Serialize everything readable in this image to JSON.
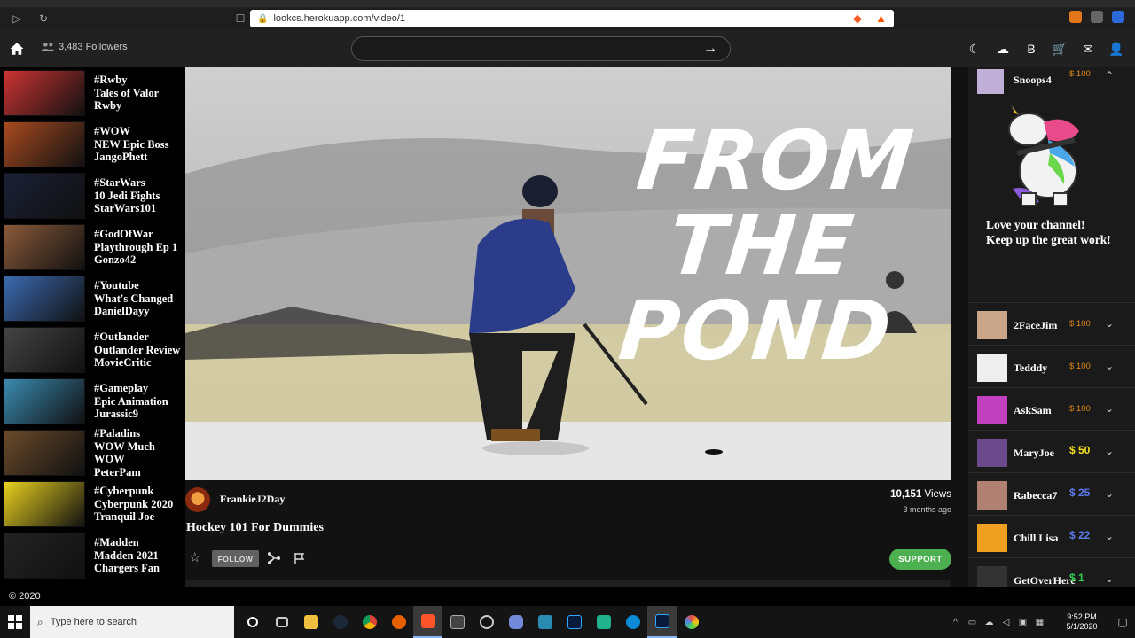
{
  "browser": {
    "url": "lookcs.herokuapp.com/video/1"
  },
  "header": {
    "followers": "3,483 Followers",
    "search_placeholder": ""
  },
  "sidebar": {
    "items": [
      {
        "tag": "#Rwby",
        "title": "Tales of Valor",
        "user": "Rwby",
        "color": "#c33"
      },
      {
        "tag": "#WOW",
        "title": "NEW Epic Boss",
        "user": "JangoPhett",
        "color": "#a84a20"
      },
      {
        "tag": "#StarWars",
        "title": "10 Jedi Fights",
        "user": "StarWars101",
        "color": "#1a2035"
      },
      {
        "tag": "#GodOfWar",
        "title": "Playthrough Ep 1",
        "user": "Gonzo42",
        "color": "#8a5a3a"
      },
      {
        "tag": "#Youtube",
        "title": "What's Changed",
        "user": "DanielDayy",
        "color": "#3a6ab0"
      },
      {
        "tag": "#Outlander",
        "title": "Outlander Review",
        "user": "MovieCritic",
        "color": "#444"
      },
      {
        "tag": "#Gameplay",
        "title": "Epic Animation",
        "user": "Jurassic9",
        "color": "#3a8ab0"
      },
      {
        "tag": "#Paladins",
        "title": "WOW Much WOW",
        "user": "PeterPam",
        "color": "#6a4a2a"
      },
      {
        "tag": "#Cyberpunk",
        "title": "Cyberpunk 2020",
        "user": "Tranquil Joe",
        "color": "#e8d020"
      },
      {
        "tag": "#Madden",
        "title": "Madden 2021",
        "user": "Chargers Fan",
        "color": "#222"
      }
    ]
  },
  "video": {
    "overlay_line1": "FROM",
    "overlay_line2": "THE",
    "overlay_line3": "POND",
    "channel": "FrankieJ2Day",
    "views_count": "10,151",
    "views_label": " Views",
    "time_ago": "3 months ago",
    "title": "Hockey 101 For Dummies",
    "follow_label": "FOLLOW",
    "support_label": "SUPPORT"
  },
  "donations": {
    "expanded": {
      "name": "Snoops4",
      "amount": "$ 100",
      "message_line1": "Love your channel!",
      "message_line2": "Keep up the great work!"
    },
    "rows": [
      {
        "name": "2FaceJim",
        "amount": "$ 100",
        "color": "#e08a1a",
        "big": false,
        "avatar": "#c9a58a"
      },
      {
        "name": "Tedddy",
        "amount": "$ 100",
        "color": "#e08a1a",
        "big": false,
        "avatar": "#eee"
      },
      {
        "name": "AskSam",
        "amount": "$ 100",
        "color": "#e08a1a",
        "big": false,
        "avatar": "#c040c0"
      },
      {
        "name": "MaryJoe",
        "amount": "$ 50",
        "color": "#f5e020",
        "big": true,
        "avatar": "#6a4a8a"
      },
      {
        "name": "Rabecca7",
        "amount": "$ 25",
        "color": "#5a7ae8",
        "big": true,
        "avatar": "#b08070"
      },
      {
        "name": "Chill Lisa",
        "amount": "$ 22",
        "color": "#5a7ae8",
        "big": true,
        "avatar": "#f0a020"
      },
      {
        "name": "GetOverHere",
        "amount": "$ 1",
        "color": "#30d050",
        "big": true,
        "avatar": "#333"
      }
    ]
  },
  "footer": {
    "text": "© 2020"
  },
  "taskbar": {
    "search_text": "Type here to search",
    "time": "9:52 PM",
    "date": "5/1/2020"
  }
}
